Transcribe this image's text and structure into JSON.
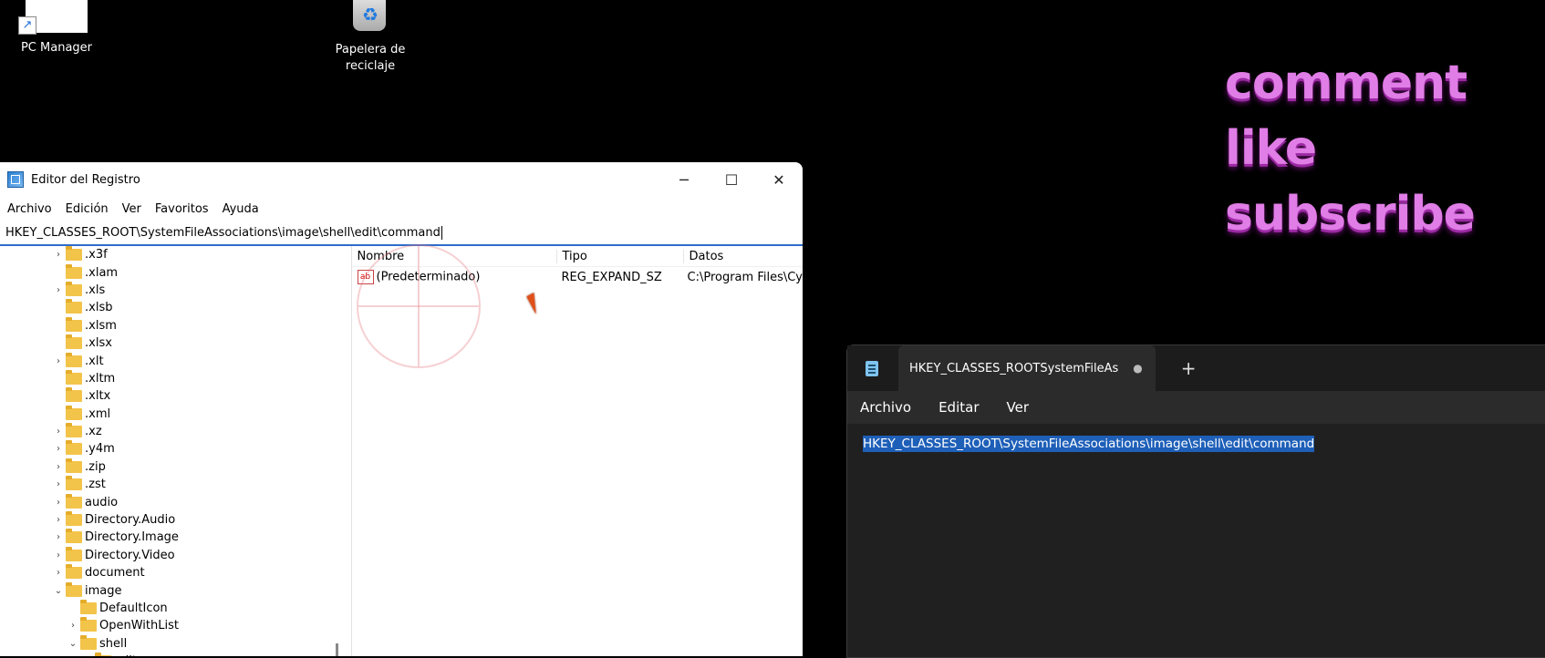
{
  "desktop": {
    "icons": [
      {
        "label": "PC Manager",
        "icon": "pc-manager-icon"
      },
      {
        "label": "Papelera de reciclaje",
        "icon": "recycle-bin-icon"
      }
    ]
  },
  "overlay": {
    "lines": [
      "comment",
      "like",
      "subscribe"
    ],
    "color": "#e07de6"
  },
  "regedit": {
    "title": "Editor del Registro",
    "menu": [
      "Archivo",
      "Edición",
      "Ver",
      "Favoritos",
      "Ayuda"
    ],
    "address": "HKEY_CLASSES_ROOT\\SystemFileAssociations\\image\\shell\\edit\\command",
    "tree": [
      {
        "label": ".x3f",
        "expandable": true
      },
      {
        "label": ".xlam",
        "expandable": false
      },
      {
        "label": ".xls",
        "expandable": true
      },
      {
        "label": ".xlsb",
        "expandable": false
      },
      {
        "label": ".xlsm",
        "expandable": false
      },
      {
        "label": ".xlsx",
        "expandable": false
      },
      {
        "label": ".xlt",
        "expandable": true
      },
      {
        "label": ".xltm",
        "expandable": false
      },
      {
        "label": ".xltx",
        "expandable": false
      },
      {
        "label": ".xml",
        "expandable": false
      },
      {
        "label": ".xz",
        "expandable": true
      },
      {
        "label": ".y4m",
        "expandable": true
      },
      {
        "label": ".zip",
        "expandable": true
      },
      {
        "label": ".zst",
        "expandable": true
      },
      {
        "label": "audio",
        "expandable": true
      },
      {
        "label": "Directory.Audio",
        "expandable": true
      },
      {
        "label": "Directory.Image",
        "expandable": true
      },
      {
        "label": "Directory.Video",
        "expandable": true
      },
      {
        "label": "document",
        "expandable": true
      },
      {
        "label": "image",
        "expandable": true,
        "expanded": true
      },
      {
        "label": "DefaultIcon",
        "expandable": false,
        "depth": 1
      },
      {
        "label": "OpenWithList",
        "expandable": true,
        "depth": 1
      },
      {
        "label": "shell",
        "expandable": true,
        "expanded": true,
        "depth": 1
      },
      {
        "label": "edit",
        "expandable": true,
        "expanded": true,
        "depth": 2
      }
    ],
    "columns": [
      "Nombre",
      "Tipo",
      "Datos"
    ],
    "values": [
      {
        "name": "(Predeterminado)",
        "type": "REG_EXPAND_SZ",
        "data": "C:\\Program Files\\Cy"
      }
    ]
  },
  "notepad": {
    "tab_title": "HKEY_CLASSES_ROOTSystemFileAs",
    "tab_dot": "●",
    "new_tab": "+",
    "menu": [
      "Archivo",
      "Editar",
      "Ver"
    ],
    "text": "HKEY_CLASSES_ROOT\\SystemFileAssociations\\image\\shell\\edit\\command"
  }
}
